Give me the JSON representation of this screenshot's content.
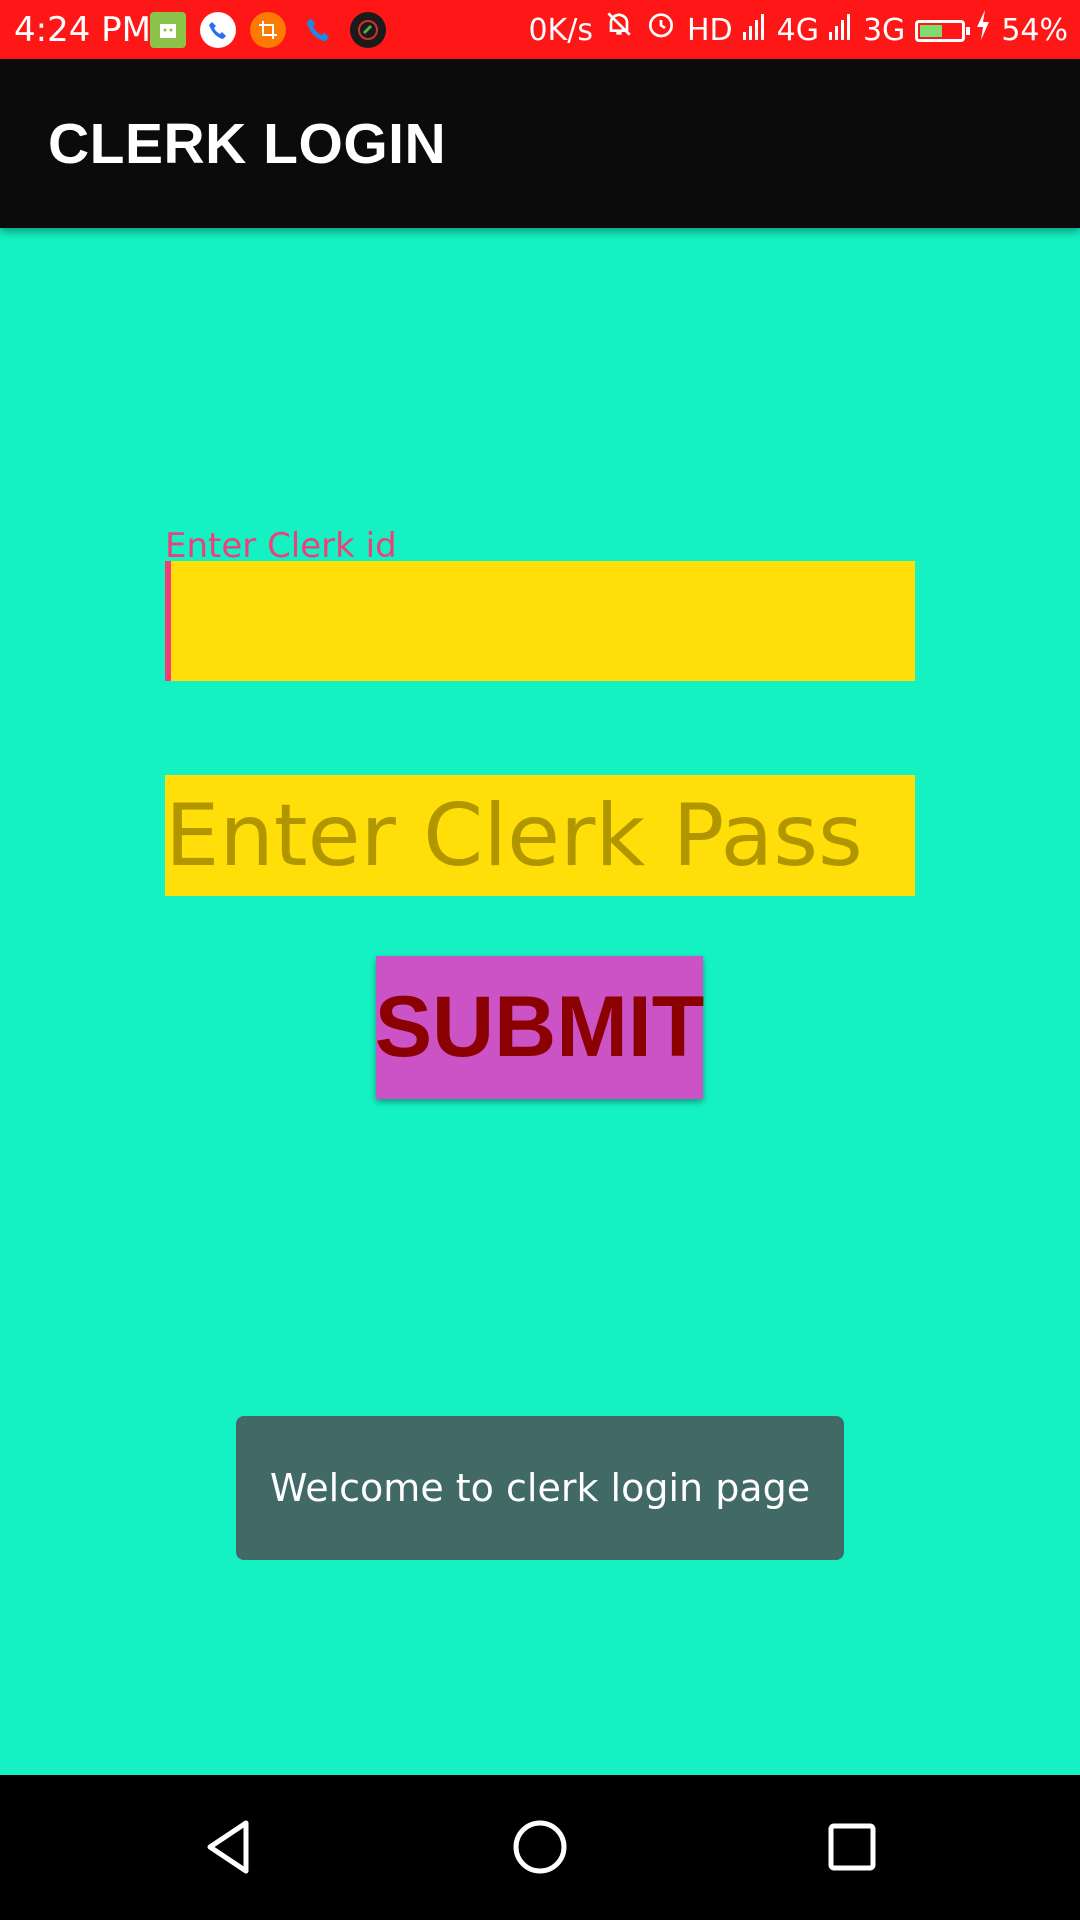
{
  "status_bar": {
    "time": "4:24 PM",
    "speed": "0K/s",
    "network": "HD",
    "net_4g": "4G",
    "net_3g": "3G",
    "battery": "54%",
    "battery_level": 0.54,
    "icons": [
      "news-icon",
      "phone-call-icon",
      "crop-icon",
      "phone-icon",
      "call-recorder-icon",
      "mute-bell-icon",
      "alarm-icon",
      "signal-icon",
      "battery-icon",
      "charging-icon"
    ]
  },
  "app_bar": {
    "title": "CLERK LOGIN"
  },
  "form": {
    "id_label": "Enter Clerk id",
    "id_value": "",
    "pass_placeholder": "Enter Clerk Pass",
    "pass_value": "",
    "submit_label": "SUBMIT"
  },
  "toast": {
    "message": "Welcome to clerk login page"
  },
  "nav_bar": {
    "icons": [
      "back-icon",
      "home-icon",
      "recent-apps-icon"
    ]
  },
  "colors": {
    "status_bar": "#ff1717",
    "app_bar": "#0b0b0b",
    "background": "#14f2c3",
    "field": "#ffde0a",
    "accent": "#ef3f7a",
    "button": "#cc53c6",
    "button_text": "#8b0000",
    "toast": "#416a67"
  }
}
